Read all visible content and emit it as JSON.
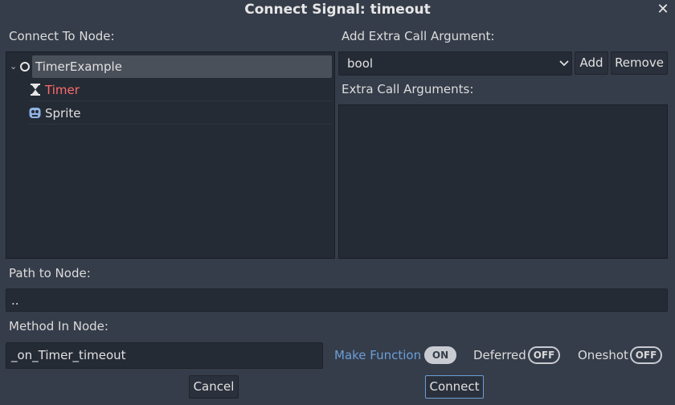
{
  "dialog": {
    "title": "Connect Signal: timeout",
    "close_glyph": "✕"
  },
  "left": {
    "header": "Connect To Node:",
    "tree": [
      {
        "name": "TimerExample",
        "icon": "node-circle-icon",
        "selected": true,
        "expanded": true,
        "color": "#e0e0e0"
      },
      {
        "name": "Timer",
        "icon": "hourglass-icon",
        "selected": false,
        "color": "#ff6b6b"
      },
      {
        "name": "Sprite",
        "icon": "sprite-face-icon",
        "selected": false,
        "color": "#e0e0e0"
      }
    ]
  },
  "right": {
    "add_arg_label": "Add Extra Call Argument:",
    "type_select_value": "bool",
    "add_button": "Add",
    "remove_button": "Remove",
    "extra_args_label": "Extra Call Arguments:"
  },
  "path": {
    "label": "Path to Node:",
    "value": ".."
  },
  "method": {
    "label": "Method In Node:",
    "value": "_on_Timer_timeout"
  },
  "toggles": {
    "make_function_label": "Make Function",
    "make_function_state": "ON",
    "deferred_label": "Deferred",
    "deferred_state": "OFF",
    "oneshot_label": "Oneshot",
    "oneshot_state": "OFF"
  },
  "footer": {
    "cancel": "Cancel",
    "connect": "Connect"
  },
  "colors": {
    "accent": "#6a9fd8",
    "timer_red": "#ff6b6b",
    "make_function_blue": "#6a9fd8"
  }
}
